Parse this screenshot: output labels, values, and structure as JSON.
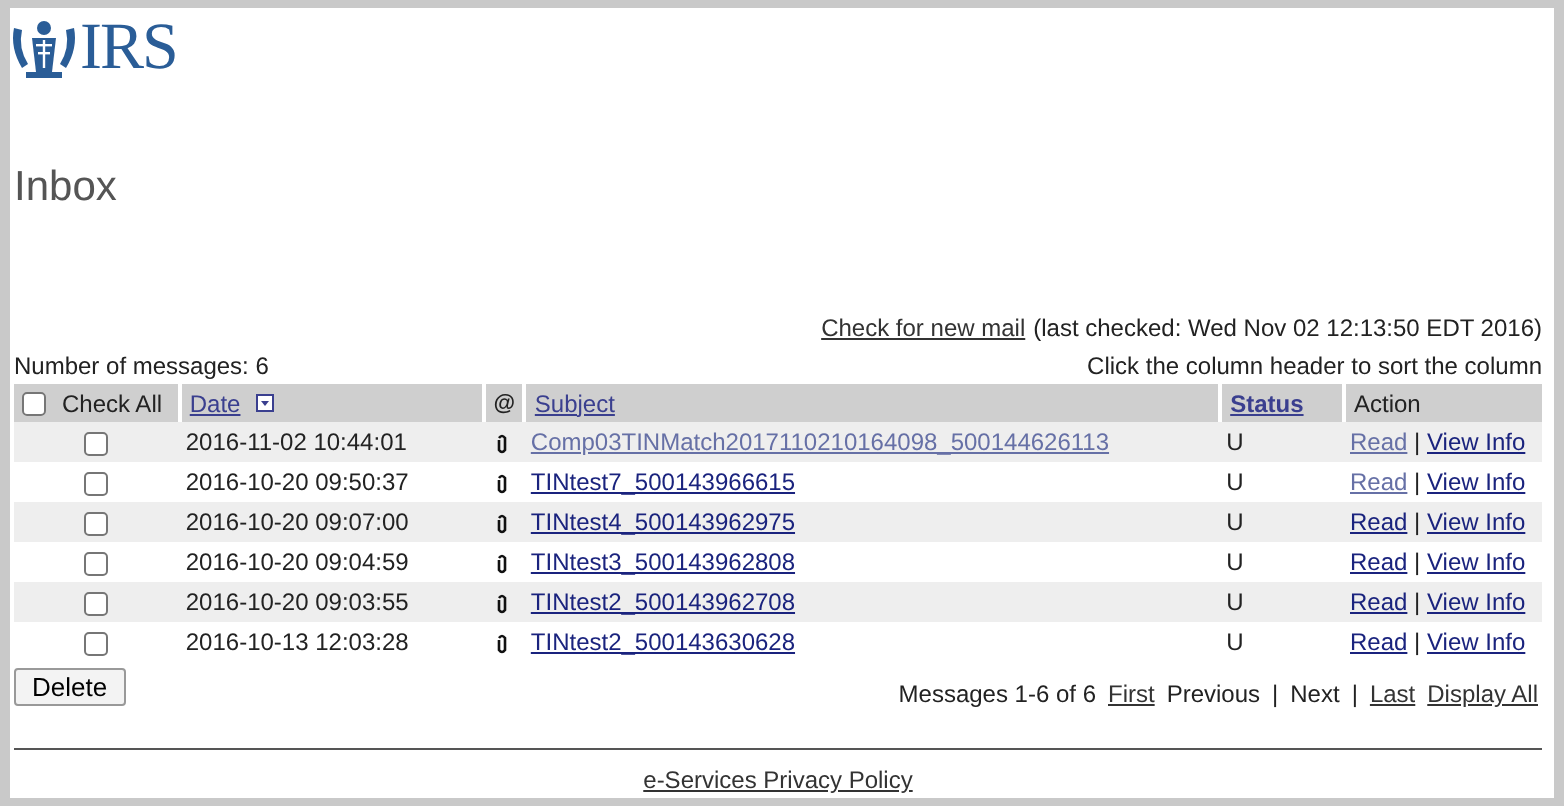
{
  "logo": {
    "text": "IRS"
  },
  "page_title": "Inbox",
  "check_mail": {
    "link": "Check for new mail",
    "note": "(last checked: Wed Nov 02 12:13:50 EDT 2016)"
  },
  "message_count": "Number of messages: 6",
  "sort_hint": "Click the column header to sort the column",
  "table": {
    "check_all": {
      "label": "Check All",
      "checked": false
    },
    "columns": [
      {
        "kind": "date",
        "label": "Date",
        "sorted": true
      },
      {
        "kind": "attach",
        "label": "@"
      },
      {
        "kind": "subject",
        "label": "Subject"
      },
      {
        "kind": "status",
        "label": "Status"
      },
      {
        "kind": "action",
        "label": "Action"
      }
    ],
    "rows": [
      {
        "checked": false,
        "date": "2016-11-02 10:44:01",
        "subject": "Comp03TINMatch2017110210164098_500144626113",
        "subject_visited": true,
        "status": "U",
        "read": "Read",
        "read_visited": true,
        "info": "View Info"
      },
      {
        "checked": false,
        "date": "2016-10-20 09:50:37",
        "subject": "TINtest7_500143966615",
        "subject_visited": false,
        "status": "U",
        "read": "Read",
        "read_visited": true,
        "info": "View Info"
      },
      {
        "checked": false,
        "date": "2016-10-20 09:07:00",
        "subject": "TINtest4_500143962975",
        "subject_visited": false,
        "status": "U",
        "read": "Read",
        "read_visited": false,
        "info": "View Info"
      },
      {
        "checked": false,
        "date": "2016-10-20 09:04:59",
        "subject": "TINtest3_500143962808",
        "subject_visited": false,
        "status": "U",
        "read": "Read",
        "read_visited": false,
        "info": "View Info"
      },
      {
        "checked": false,
        "date": "2016-10-20 09:03:55",
        "subject": "TINtest2_500143962708",
        "subject_visited": false,
        "status": "U",
        "read": "Read",
        "read_visited": false,
        "info": "View Info"
      },
      {
        "checked": false,
        "date": "2016-10-13 12:03:28",
        "subject": "TINtest2_500143630628",
        "subject_visited": false,
        "status": "U",
        "read": "Read",
        "read_visited": false,
        "info": "View Info"
      }
    ],
    "separator": "|"
  },
  "delete_button": "Delete",
  "pagination": [
    {
      "kind": "text",
      "text": "Messages 1-6 of 6"
    },
    {
      "kind": "link",
      "text": "First"
    },
    {
      "kind": "text",
      "text": "Previous"
    },
    {
      "kind": "text",
      "text": "|"
    },
    {
      "kind": "text",
      "text": "Next"
    },
    {
      "kind": "text",
      "text": "|"
    },
    {
      "kind": "link",
      "text": "Last"
    },
    {
      "kind": "link",
      "text": "Display All"
    }
  ],
  "footer_link": "e-Services Privacy Policy"
}
